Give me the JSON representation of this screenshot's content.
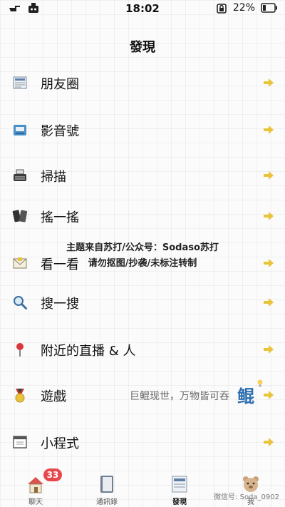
{
  "status_bar": {
    "time": "18:02",
    "battery": "22%"
  },
  "page": {
    "title": "發現"
  },
  "menu": [
    {
      "label": "朋友圈",
      "icon": "newspaper-icon"
    },
    {
      "label": "影音號",
      "icon": "video-channel-icon"
    },
    {
      "label": "掃描",
      "icon": "typewriter-scan-icon"
    },
    {
      "label": "搖一搖",
      "icon": "phones-shake-icon"
    },
    {
      "label": "看一看",
      "icon": "envelope-icon"
    },
    {
      "label": "搜一搜",
      "icon": "magnifier-icon"
    },
    {
      "label": "附近的直播 & 人",
      "icon": "pin-icon"
    },
    {
      "label": "遊戲",
      "icon": "medal-game-icon",
      "subtitle": "巨鲲现世，万物皆可吞"
    },
    {
      "label": "小程式",
      "icon": "window-app-icon"
    }
  ],
  "watermark": {
    "line1": "主题来自苏打/公众号：Sodaso苏打",
    "line2": "请勿抠图/抄袭/未标注转制"
  },
  "promo": {
    "glyph": "鲲"
  },
  "tabs": [
    {
      "label": "聊天",
      "badge": "33",
      "icon": "house-icon"
    },
    {
      "label": "通訊錄",
      "icon": "notebook-icon"
    },
    {
      "label": "發現",
      "icon": "newspaper-tab-icon"
    },
    {
      "label": "我",
      "icon": "bear-icon"
    }
  ],
  "brand_watermark": "微信号: Soda_0902",
  "colors": {
    "accent": "#e9c43a",
    "badge": "#e5484d"
  }
}
